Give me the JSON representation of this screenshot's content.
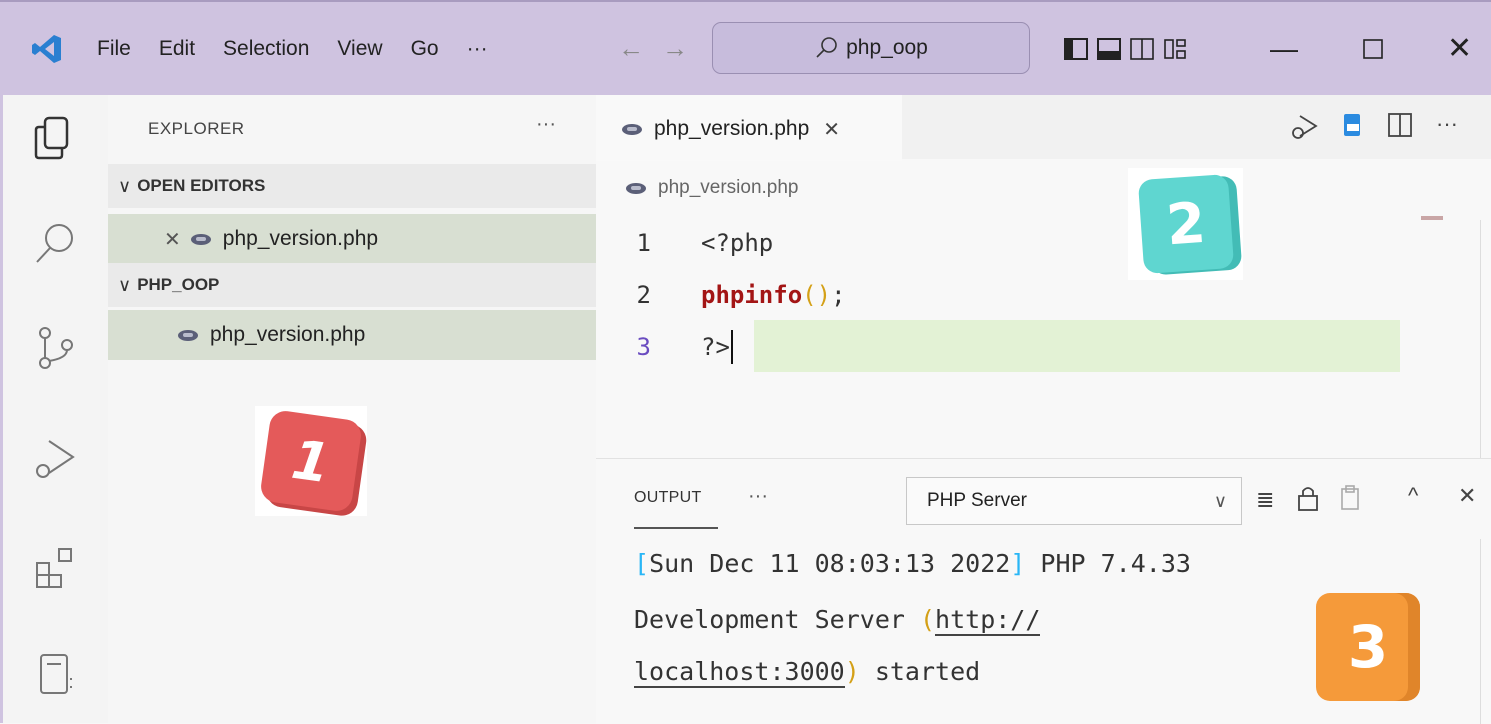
{
  "menu": {
    "file": "File",
    "edit": "Edit",
    "selection": "Selection",
    "view": "View",
    "go": "Go",
    "more": "···"
  },
  "search": {
    "text": "php_oop"
  },
  "explorer": {
    "title": "EXPLORER",
    "more": "···",
    "open_editors_label": "OPEN EDITORS",
    "open_file": "php_version.php",
    "folder_label": "PHP_OOP",
    "folder_file": "php_version.php"
  },
  "editor": {
    "tab_label": "php_version.php",
    "breadcrumb": "php_version.php",
    "lines": [
      {
        "num": "1",
        "text": "<?php"
      },
      {
        "num": "2",
        "fn": "phpinfo",
        "paren_open": "(",
        "paren_close": ")",
        "semi": ";"
      },
      {
        "num": "3",
        "text": "?>"
      }
    ],
    "more": "···"
  },
  "panel": {
    "tab": "OUTPUT",
    "more": "···",
    "channel": "PHP Server",
    "log": {
      "bracket_open": "[",
      "date": "Sun Dec 11 08:03:13 2022",
      "bracket_close": "]",
      "rest1": " PHP 7.4.33",
      "line2_pre": "Development Server ",
      "paren_open": "(",
      "url_part1": "http://",
      "url_part2": "localhost:3000",
      "paren_close": ")",
      "line3_post": " started"
    }
  },
  "badges": [
    {
      "label": "1",
      "color": "#e45a5a"
    },
    {
      "label": "2",
      "color": "#5fd6d0"
    },
    {
      "label": "3",
      "color": "#f59a3a"
    }
  ],
  "colors": {
    "titlebar": "#cfc3e0",
    "fn": "#a31515",
    "paren": "#d4a017",
    "log_bracket": "#29b6f6"
  }
}
